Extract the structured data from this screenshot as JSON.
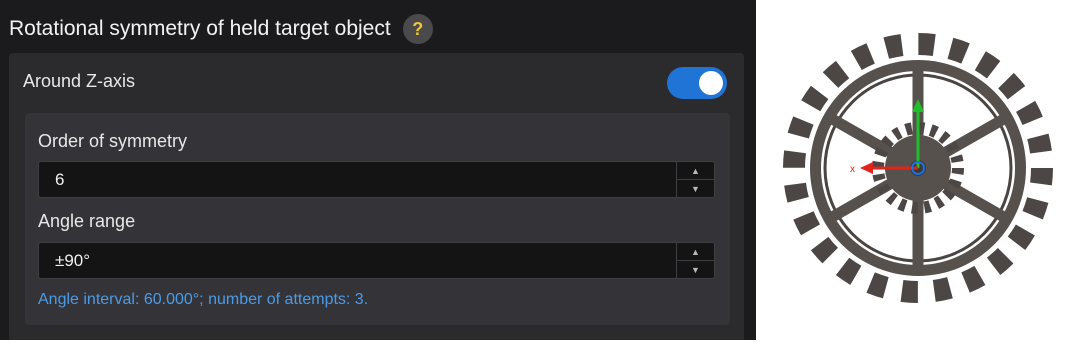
{
  "section": {
    "title": "Rotational symmetry of held target object",
    "help_icon": "question-mark-icon",
    "help_glyph": "?"
  },
  "axis_toggle": {
    "label": "Around Z-axis",
    "enabled": true,
    "accent_color": "#1f74d6"
  },
  "order_field": {
    "label": "Order of symmetry",
    "value": "6"
  },
  "angle_field": {
    "label": "Angle range",
    "value": "±90°"
  },
  "info": {
    "text": "Angle interval: 60.000°; number of attempts: 3."
  },
  "preview": {
    "object": "gear",
    "axis_labels": {
      "x": "x"
    },
    "axis_colors": {
      "x": "#e0241b",
      "y": "#1fbf2a",
      "z": "#1e6fe0"
    }
  },
  "colors": {
    "panel_bg": "#1b1b1d",
    "card_bg": "#2b2b2e",
    "info_text": "#4a9be8",
    "help_mark": "#f4c430"
  }
}
